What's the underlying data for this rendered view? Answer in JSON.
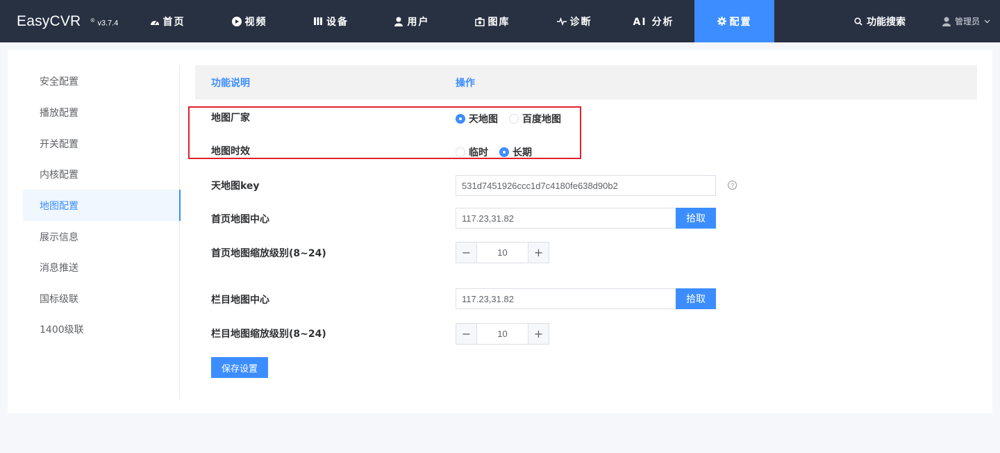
{
  "header": {
    "brand_name": "EasyCVR",
    "brand_reg": "®",
    "version": "v3.7.4",
    "nav": [
      {
        "label": "首页",
        "icon": "dashboard-icon"
      },
      {
        "label": "视频",
        "icon": "play-icon"
      },
      {
        "label": "设备",
        "icon": "device-icon"
      },
      {
        "label": "用户",
        "icon": "user-icon"
      },
      {
        "label": "图库",
        "icon": "gallery-icon"
      },
      {
        "label": "诊断",
        "icon": "pulse-icon"
      },
      {
        "label": "AI 分析",
        "icon": ""
      },
      {
        "label": "配置",
        "icon": "gear-icon"
      }
    ],
    "active_nav": "配置",
    "search_label": "功能搜索",
    "user_label": "管理员"
  },
  "sidebar": {
    "items": [
      {
        "label": "安全配置"
      },
      {
        "label": "播放配置"
      },
      {
        "label": "开关配置"
      },
      {
        "label": "内核配置"
      },
      {
        "label": "地图配置"
      },
      {
        "label": "展示信息"
      },
      {
        "label": "消息推送"
      },
      {
        "label": "国标级联"
      },
      {
        "label": "1400级联"
      }
    ],
    "active": "地图配置"
  },
  "table": {
    "col_desc": "功能说明",
    "col_action": "操作"
  },
  "form": {
    "map_vendor": {
      "label": "地图厂家",
      "options": [
        "天地图",
        "百度地图"
      ],
      "selected": "天地图"
    },
    "map_validity": {
      "label": "地图时效",
      "options": [
        "临时",
        "长期"
      ],
      "selected": "长期"
    },
    "tianditu_key": {
      "label": "天地图key",
      "value": "531d7451926ccc1d7c4180fe638d90b2",
      "help": "?"
    },
    "home_center": {
      "label": "首页地图中心",
      "value": "117.23,31.82",
      "pick_label": "拾取"
    },
    "home_zoom": {
      "label": "首页地图缩放级别(8~24)",
      "value": "10",
      "minus": "−",
      "plus": "+"
    },
    "column_center": {
      "label": "栏目地图中心",
      "value": "117.23,31.82",
      "pick_label": "拾取"
    },
    "column_zoom": {
      "label": "栏目地图缩放级别(8~24)",
      "value": "10",
      "minus": "−",
      "plus": "+"
    },
    "save_label": "保存设置"
  },
  "colors": {
    "topbar_bg": "#273142",
    "accent": "#3c8dff",
    "highlight_border": "#e0202a"
  }
}
